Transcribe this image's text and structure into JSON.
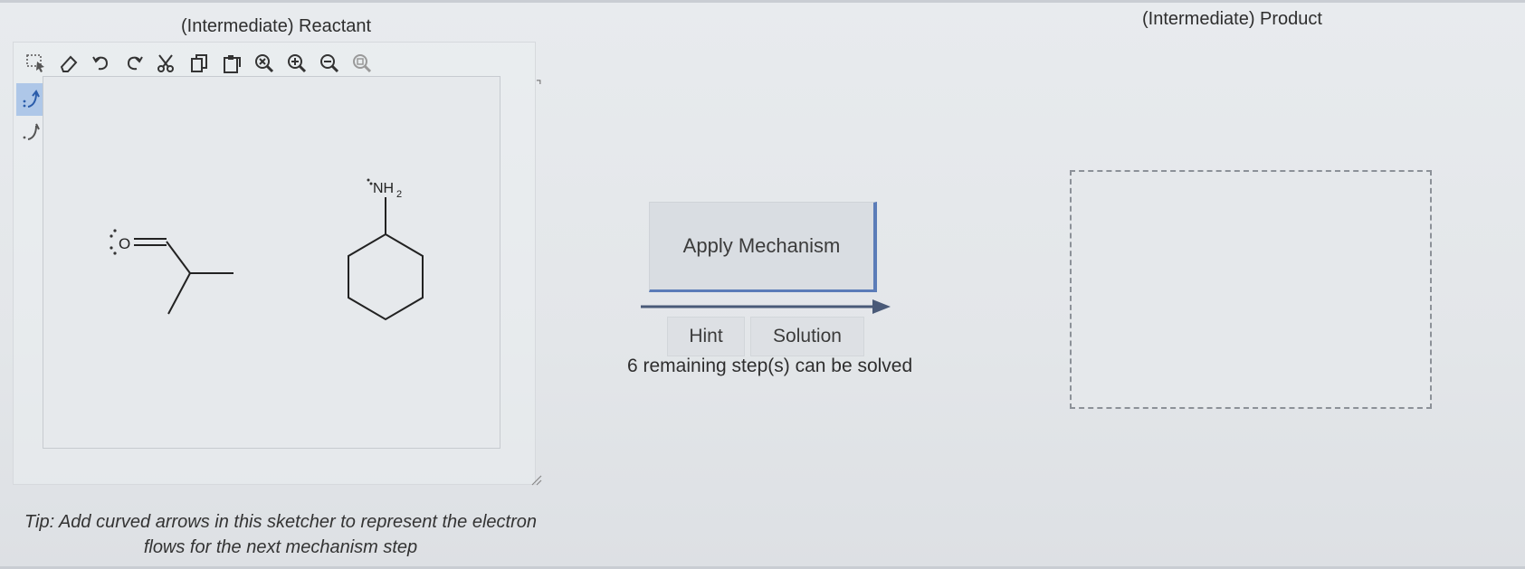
{
  "reactant_panel": {
    "title": "(Intermediate) Reactant",
    "toolbar": [
      {
        "name": "select-icon"
      },
      {
        "name": "eraser-icon"
      },
      {
        "name": "undo-icon"
      },
      {
        "name": "redo-icon"
      },
      {
        "name": "cut-icon"
      },
      {
        "name": "copy-icon"
      },
      {
        "name": "paste-icon"
      },
      {
        "name": "zoom-reset-icon"
      },
      {
        "name": "zoom-in-icon"
      },
      {
        "name": "zoom-out-icon"
      },
      {
        "name": "zoom-fit-icon"
      }
    ],
    "side_tools": [
      {
        "name": "curved-arrow-pair-icon",
        "active": true
      },
      {
        "name": "curved-arrow-single-icon",
        "active": false
      }
    ],
    "molecules": {
      "aldehyde_oxygen": "O",
      "amine_group": "NH",
      "amine_subscript": "2"
    },
    "tip": "Tip: Add curved arrows in this sketcher to represent the electron flows for the next mechanism step"
  },
  "mechanism": {
    "apply_label": "Apply Mechanism",
    "hint_label": "Hint",
    "solution_label": "Solution",
    "remaining_text": "6 remaining step(s) can be solved"
  },
  "product_panel": {
    "title": "(Intermediate) Product"
  },
  "colors": {
    "accent_border": "#5b7cb8",
    "active_tool": "#aec7e8"
  }
}
